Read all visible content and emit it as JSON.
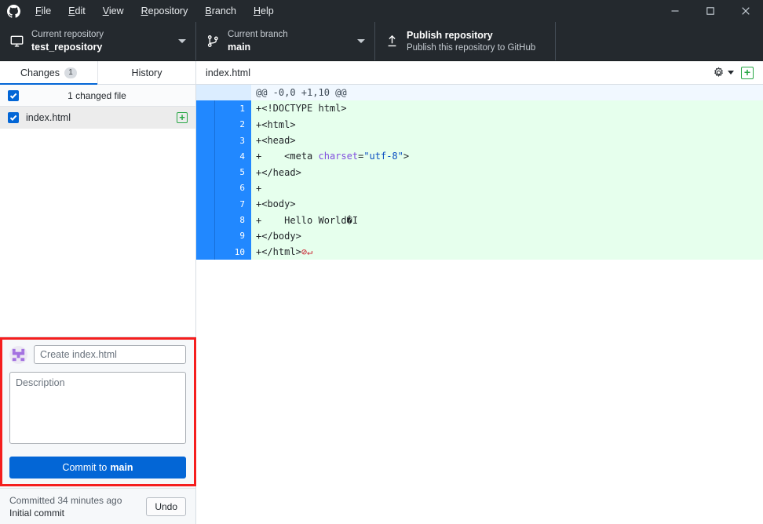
{
  "window": {
    "app_icon": "github-logo-icon",
    "controls": {
      "minimize": "minimize-icon",
      "maximize": "maximize-icon",
      "close": "close-icon"
    }
  },
  "menu": {
    "items": [
      {
        "label": "File",
        "mnemonic": "F"
      },
      {
        "label": "Edit",
        "mnemonic": "E"
      },
      {
        "label": "View",
        "mnemonic": "V"
      },
      {
        "label": "Repository",
        "mnemonic": "R"
      },
      {
        "label": "Branch",
        "mnemonic": "B"
      },
      {
        "label": "Help",
        "mnemonic": "H"
      }
    ]
  },
  "toolbar": {
    "repository": {
      "label": "Current repository",
      "value": "test_repository",
      "icon": "desktop-icon"
    },
    "branch": {
      "label": "Current branch",
      "value": "main",
      "icon": "git-branch-icon"
    },
    "publish": {
      "title": "Publish repository",
      "subtitle": "Publish this repository to GitHub",
      "icon": "upload-icon"
    }
  },
  "sidebar": {
    "tabs": [
      {
        "label": "Changes",
        "badge": "1",
        "active": true
      },
      {
        "label": "History",
        "badge": "",
        "active": false
      }
    ],
    "changes_header": {
      "text": "1 changed file",
      "checked": true
    },
    "files": [
      {
        "name": "index.html",
        "checked": true,
        "status": "+",
        "status_name": "added"
      }
    ]
  },
  "commit_form": {
    "avatar": "user-avatar",
    "summary_placeholder": "Create index.html",
    "summary_value": "",
    "description_placeholder": "Description",
    "description_value": "",
    "commit_button_prefix": "Commit to ",
    "commit_button_branch": "main"
  },
  "undo_bar": {
    "status": "Committed 34 minutes ago",
    "commit_message": "Initial commit",
    "undo_label": "Undo"
  },
  "diff": {
    "filename": "index.html",
    "settings_icon": "gear-icon",
    "settings_caret": "chevron-down-icon",
    "expand_icon": "add-box-icon",
    "hunk_header": "@@ -0,0 +1,10 @@",
    "lines": [
      {
        "no": "1",
        "marker": "+",
        "parts": [
          {
            "t": "tag",
            "s": "<!DOCTYPE html>"
          }
        ]
      },
      {
        "no": "2",
        "marker": "+",
        "parts": [
          {
            "t": "tag",
            "s": "<html>"
          }
        ]
      },
      {
        "no": "3",
        "marker": "+",
        "parts": [
          {
            "t": "tag",
            "s": "<head>"
          }
        ]
      },
      {
        "no": "4",
        "marker": "+",
        "parts": [
          {
            "t": "txt",
            "s": "    "
          },
          {
            "t": "tag",
            "s": "<meta "
          },
          {
            "t": "attr",
            "s": "charset"
          },
          {
            "t": "tag",
            "s": "="
          },
          {
            "t": "val",
            "s": "\"utf-8\""
          },
          {
            "t": "tag",
            "s": ">"
          }
        ]
      },
      {
        "no": "5",
        "marker": "+",
        "parts": [
          {
            "t": "tag",
            "s": "</head>"
          }
        ]
      },
      {
        "no": "6",
        "marker": "+",
        "parts": [
          {
            "t": "txt",
            "s": ""
          }
        ]
      },
      {
        "no": "7",
        "marker": "+",
        "parts": [
          {
            "t": "tag",
            "s": "<body>"
          }
        ]
      },
      {
        "no": "8",
        "marker": "+",
        "parts": [
          {
            "t": "txt",
            "s": "    Hello World"
          },
          {
            "t": "repl",
            "s": "�"
          },
          {
            "t": "txt",
            "s": "I"
          }
        ]
      },
      {
        "no": "9",
        "marker": "+",
        "parts": [
          {
            "t": "tag",
            "s": "</body>"
          }
        ]
      },
      {
        "no": "10",
        "marker": "+",
        "parts": [
          {
            "t": "tag",
            "s": "</html>"
          },
          {
            "t": "nonl",
            "s": "⊘↵"
          }
        ]
      }
    ]
  },
  "colors": {
    "titlebar_bg": "#24292e",
    "accent_blue": "#0366d6",
    "diff_gutter_selected": "#2188ff",
    "diff_added_bg": "#e6ffed",
    "diff_hunk_bg": "#f1f8ff",
    "status_added_green": "#28a745",
    "annotation_red": "#f51e1e",
    "avatar_purple": "#a371e0"
  }
}
